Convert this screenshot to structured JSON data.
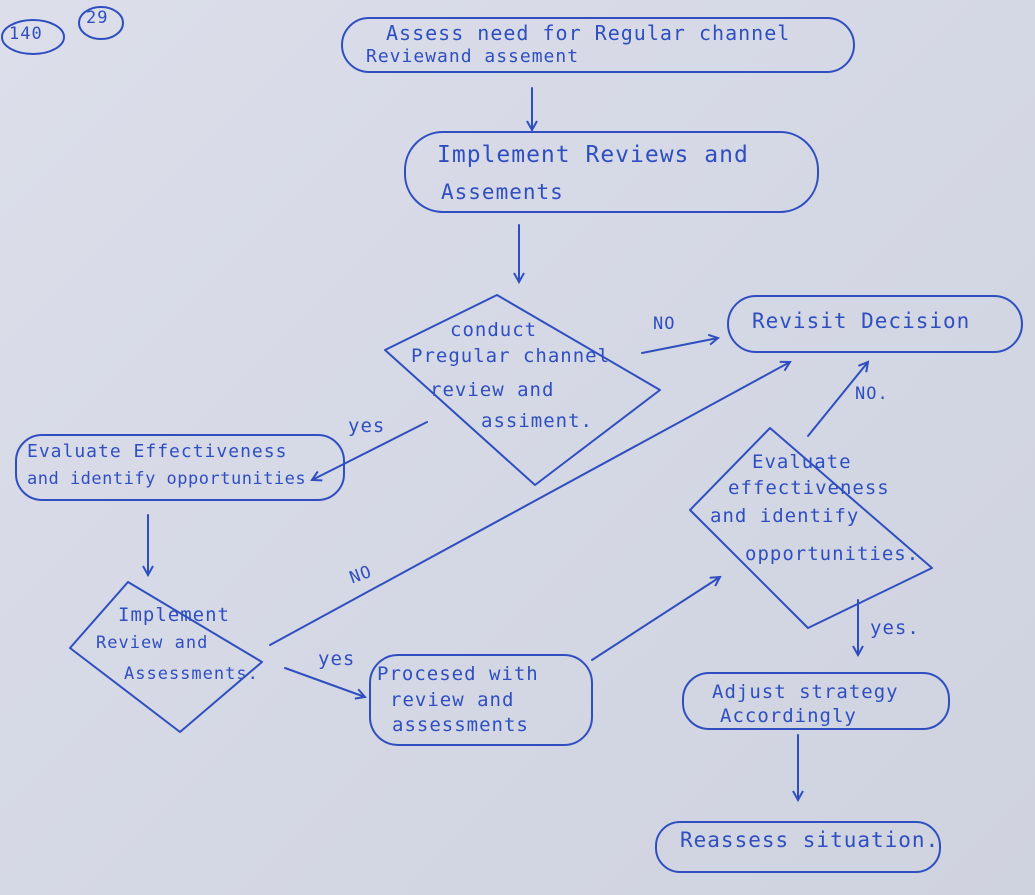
{
  "ink_color": "#2f4fc0",
  "corner_marks": [
    "140",
    "29"
  ],
  "nodes": {
    "top": [
      "Assess need for Regular channel",
      "Reviewand assement"
    ],
    "implement_reviews": [
      "Implement Reviews and",
      "Assements"
    ],
    "conduct": [
      "conduct",
      "Pregular channel",
      "review and",
      "assiment."
    ],
    "revisit": [
      "Revisit Decision"
    ],
    "evaluate_left": [
      "Evaluate Effectiveness",
      "and identify opportunities"
    ],
    "implement_review_diamond": [
      "Implement",
      "Review and",
      "Assessments."
    ],
    "proceed": [
      "Procesed with",
      "review and",
      "assessments"
    ],
    "evaluate_right": [
      "Evaluate",
      "effectiveness",
      "and identify",
      "opportunities."
    ],
    "adjust": [
      "Adjust strategy",
      "Accordingly"
    ],
    "reassess": [
      "Reassess situation."
    ]
  },
  "edge_labels": {
    "conduct_no": "NO",
    "conduct_yes": "yes",
    "implement_no": "NO",
    "implement_yes": "yes",
    "evaluate_right_no": "NO.",
    "evaluate_right_yes": "yes."
  }
}
